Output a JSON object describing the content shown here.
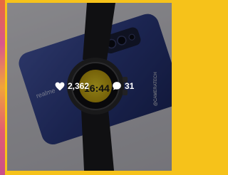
{
  "post": {
    "likes_count": "2,362",
    "comments_count": "31",
    "watermark": "@CAMERATECH",
    "phone_brand": "realme",
    "watch_time": "16:44"
  },
  "icons": {
    "likes": "heart-icon",
    "comments": "speech-bubble-icon"
  },
  "colors": {
    "frame_border": "#f6c21a",
    "overlay": "#000000",
    "stat_text": "#ffffff",
    "phone_body": "#2f3f8a",
    "watch_dial": "#f2d21a"
  }
}
